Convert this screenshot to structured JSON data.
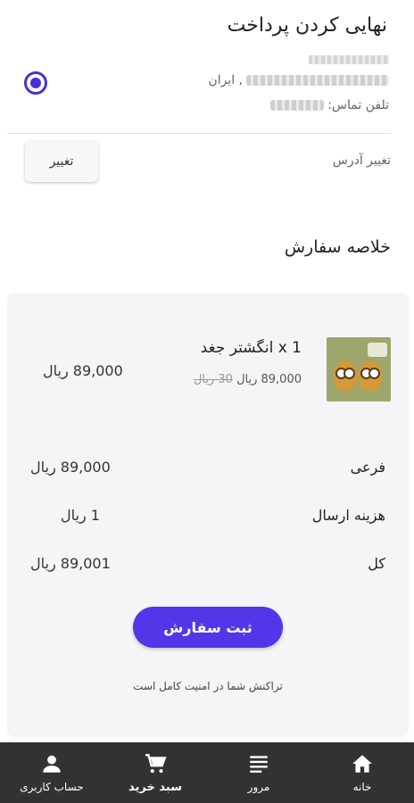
{
  "header": {
    "title": "نهایی کردن پرداخت"
  },
  "address": {
    "line2_suffix": ", ایران",
    "phone_label": "تلفن تماس:"
  },
  "change_address": {
    "label": "تغییر آدرس",
    "button_label": "تغییر"
  },
  "summary": {
    "title": "خلاصه سفارش",
    "product": {
      "name": "1 x انگشتر جغد",
      "old_price": "30 ریال",
      "price": "89,000 ریال",
      "line_total": "89,000 ریال"
    },
    "rows": [
      {
        "label": "فرعی",
        "value": "89,000 ریال"
      },
      {
        "label": "هزینه ارسال",
        "value": "1 ریال"
      },
      {
        "label": "کل",
        "value": "89,001 ریال"
      }
    ],
    "submit_label": "ثبت سفارش",
    "secure_note": "تراکنش شما در امنیت کامل است"
  },
  "bottom_nav": [
    {
      "label": "خانه",
      "icon": "home-icon",
      "active": false
    },
    {
      "label": "مرور",
      "icon": "list-icon",
      "active": false
    },
    {
      "label": "سبد خرید",
      "icon": "cart-icon",
      "active": true
    },
    {
      "label": "حساب کاربری",
      "icon": "person-icon",
      "active": false
    }
  ],
  "colors": {
    "accent": "#5137e8",
    "nav_bg": "#303233",
    "card_bg": "#f5f5f8"
  }
}
